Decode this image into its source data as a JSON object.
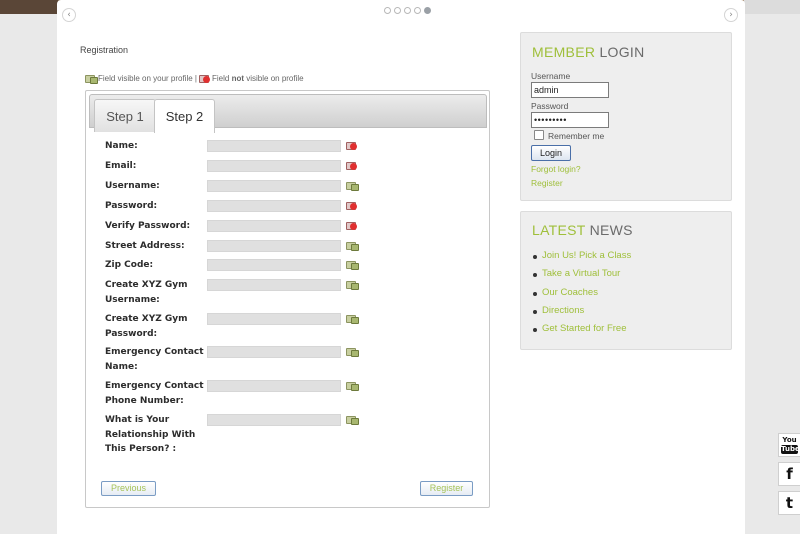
{
  "slider": {
    "prev_icon": "‹",
    "next_icon": "›",
    "dot_count": 5,
    "active_dot": 5
  },
  "page": {
    "title": "Registration"
  },
  "legend": {
    "visible_text": "Field visible on your profile |",
    "hidden_prefix": "Field ",
    "hidden_bold": "not",
    "hidden_suffix": " visible on profile"
  },
  "tabs": [
    {
      "label": "Step 1",
      "active": false
    },
    {
      "label": "Step 2",
      "active": true
    }
  ],
  "fields": [
    {
      "label": "Name:",
      "value": "",
      "visibility": "hidden"
    },
    {
      "label": "Email:",
      "value": "",
      "visibility": "hidden"
    },
    {
      "label": "Username:",
      "value": "",
      "visibility": "visible"
    },
    {
      "label": "Password:",
      "value": "",
      "visibility": "hidden"
    },
    {
      "label": "Verify Password:",
      "value": "",
      "visibility": "hidden"
    },
    {
      "label": "Street Address:",
      "value": "",
      "visibility": "visible"
    },
    {
      "label": "Zip Code:",
      "value": "",
      "visibility": "visible"
    },
    {
      "label": "Create XYZ Gym Username:",
      "value": "",
      "visibility": "visible"
    },
    {
      "label": "Create XYZ Gym Password:",
      "value": "",
      "visibility": "visible"
    },
    {
      "label": "Emergency Contact Name:",
      "value": "",
      "visibility": "visible"
    },
    {
      "label": "Emergency Contact Phone Number:",
      "value": "",
      "visibility": "visible"
    },
    {
      "label": "What is Your Relationship With This Person? :",
      "value": "",
      "visibility": "visible"
    }
  ],
  "form_buttons": {
    "previous": "Previous",
    "register": "Register"
  },
  "login": {
    "heading_green": "MEMBER",
    "heading_gray": " LOGIN",
    "username_label": "Username",
    "username_value": "admin",
    "password_label": "Password",
    "password_value": "•••••••••",
    "remember_label": "Remember me",
    "login_button": "Login",
    "forgot_link": "Forgot login?",
    "register_link": "Register"
  },
  "news": {
    "heading_green": "LATEST",
    "heading_gray": " NEWS",
    "items": [
      "Join Us! Pick a Class",
      "Take a Virtual Tour",
      "Our Coaches",
      "Directions",
      "Get Started for Free"
    ]
  },
  "social": {
    "youtube_top": "You",
    "youtube_bottom": "Tube",
    "facebook": "f",
    "twitter": "t"
  },
  "colors": {
    "accent_green": "#9fbf3a",
    "hidden_red": "#e03030"
  }
}
